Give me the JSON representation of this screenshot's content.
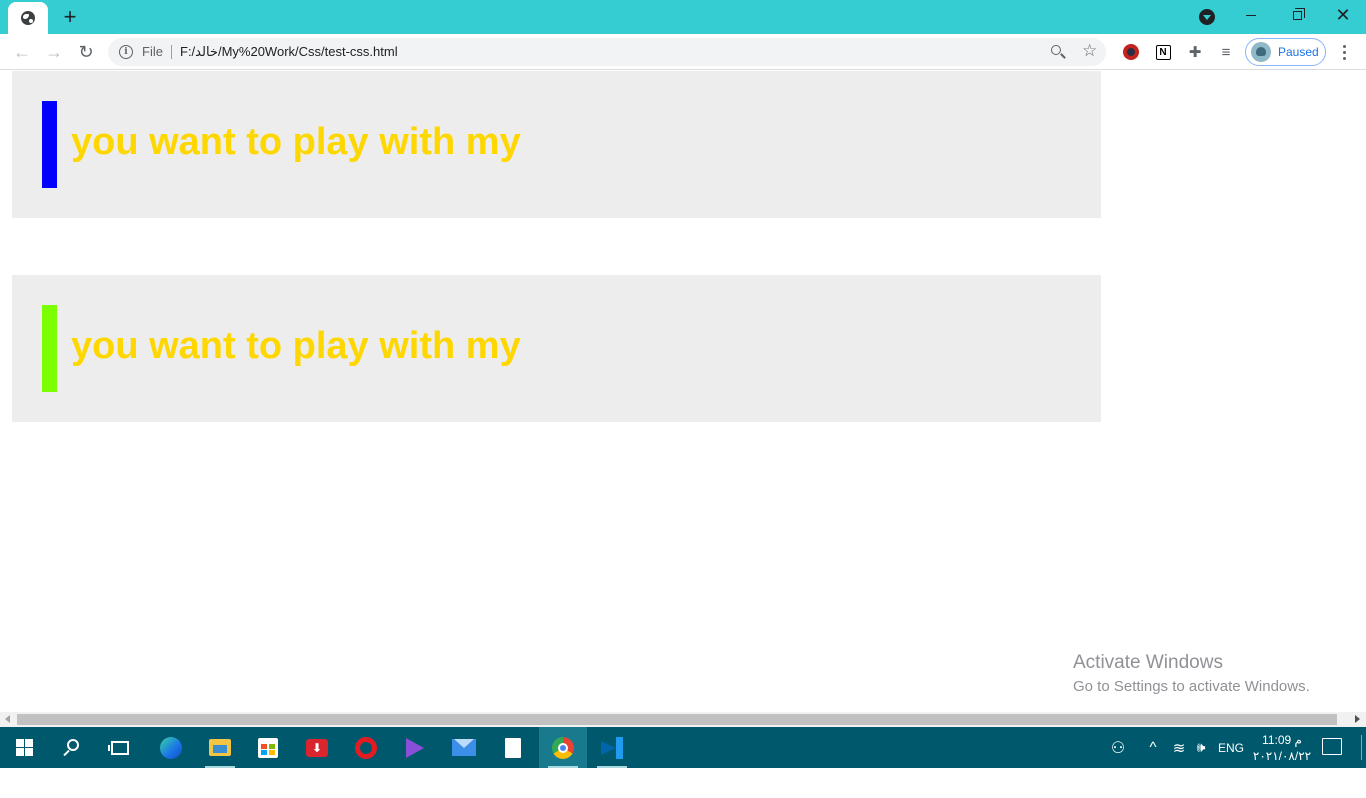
{
  "browser": {
    "new_tab_symbol": "+",
    "tab_search_icon": "chevron-down-icon",
    "window_controls": {
      "minimize": "—",
      "close": "✕"
    },
    "nav": {
      "back": "←",
      "forward": "→",
      "reload": "↻"
    },
    "omnibox": {
      "scheme_label": "File",
      "url": "F:/خالد/My%20Work/Css/test-css.html"
    },
    "star_glyph": "☆",
    "extensions": {
      "notion_letter": "N",
      "puzzle_glyph": "✚",
      "media_glyph": "≡"
    },
    "profile": {
      "label": "Paused"
    }
  },
  "page": {
    "cards": [
      {
        "heading": "you want to play with my",
        "bar_color": "#0000ff"
      },
      {
        "heading": "you want to play with my",
        "bar_color": "#7cff00"
      }
    ],
    "heading_color": "#ffd700",
    "card_background": "#ededed"
  },
  "watermark": {
    "title": "Activate Windows",
    "subtitle": "Go to Settings to activate Windows."
  },
  "taskbar": {
    "pinned": [
      "start-icon",
      "search-icon",
      "task-view-icon",
      "edge-icon",
      "file-explorer-icon",
      "store-icon",
      "download-manager-icon",
      "opera-icon",
      "media-player-icon",
      "mail-icon",
      "notepad-icon",
      "chrome-icon",
      "vscode-icon"
    ],
    "idm_glyph": "⬇",
    "tray": {
      "people_glyph": "⚇",
      "chevron_glyph": "^",
      "wifi_glyph": "≋",
      "volume_glyph": "🕪",
      "language": "ENG",
      "time": "11:09 م",
      "date": "٢٠٢١/٠٨/٢٢"
    }
  }
}
